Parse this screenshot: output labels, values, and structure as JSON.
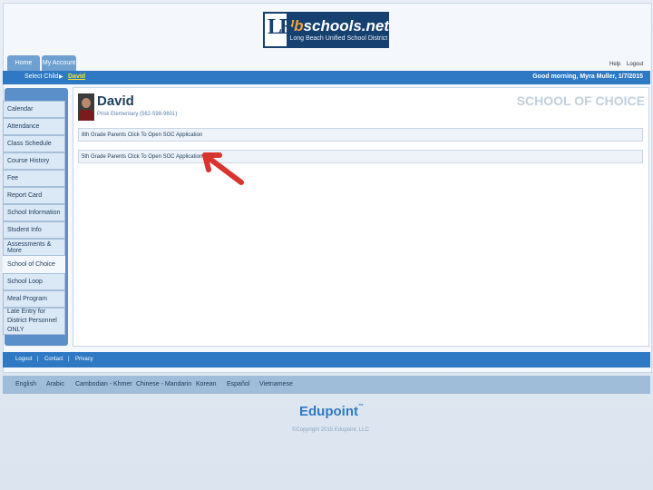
{
  "brand": {
    "logo_name_prefix": "lb",
    "logo_name_suffix": "schools.net",
    "logo_subtitle": "Long Beach Unified School District",
    "logo_mark": "LB",
    "accent_color": "#2f79c4"
  },
  "tabs": [
    {
      "label": "Home"
    },
    {
      "label": "My Account"
    }
  ],
  "top_links": {
    "help": "Help",
    "logout": "Logout"
  },
  "topbar": {
    "select_child_label": "Select Child",
    "selected_child": "David",
    "greeting": "Good morning, Myra Muller, 1/7/2015"
  },
  "sidebar": {
    "items": [
      {
        "label": "Calendar"
      },
      {
        "label": "Attendance"
      },
      {
        "label": "Class Schedule"
      },
      {
        "label": "Course History"
      },
      {
        "label": "Fee"
      },
      {
        "label": "Report Card"
      },
      {
        "label": "School Information"
      },
      {
        "label": "Student Info"
      },
      {
        "label": "Assessments & More"
      },
      {
        "label": "School of Choice"
      },
      {
        "label": "School Loop"
      },
      {
        "label": "Meal Program"
      },
      {
        "label": "Late Entry for District Personnel ONLY"
      }
    ],
    "active_index": 9
  },
  "main": {
    "student_name": "David",
    "school_line": "Prisk Elementary (562-598-9601)",
    "section_title": "SCHOOL OF CHOICE",
    "rows": [
      {
        "label": "8th Grade Parents Click To Open SOC Application"
      },
      {
        "label": "5th Grade Parents Click To Open SOC Application"
      }
    ]
  },
  "footer": {
    "links": [
      {
        "label": "Logout"
      },
      {
        "label": "Contact"
      },
      {
        "label": "Privacy"
      }
    ],
    "languages": [
      {
        "label": "English"
      },
      {
        "label": "Arabic"
      },
      {
        "label": "Cambodian - Khmer"
      },
      {
        "label": "Chinese - Mandarin"
      },
      {
        "label": "Korean"
      },
      {
        "label": "Español"
      },
      {
        "label": "Vietnamese"
      }
    ],
    "vendor": "Edupoint",
    "copyright": "©Copyright 2015 Edupoint, LLC"
  }
}
